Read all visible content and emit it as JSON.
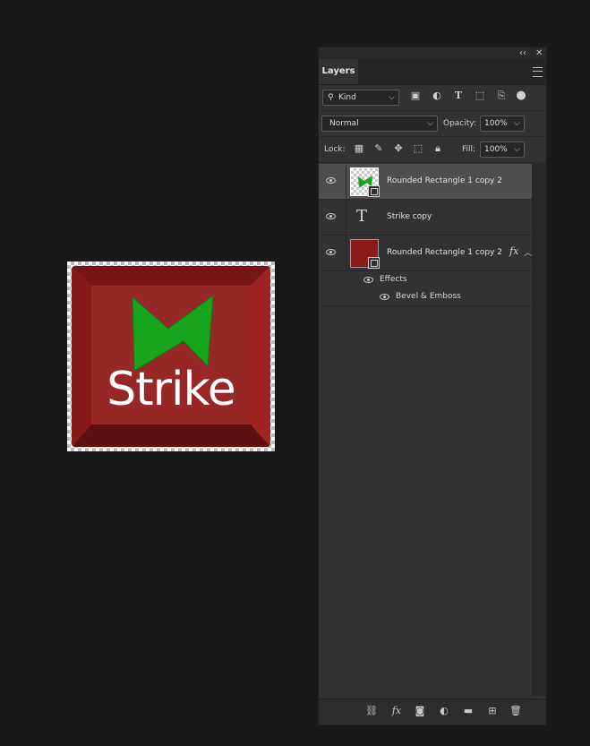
{
  "canvas": {
    "text": "Strike",
    "colors": {
      "key": "#8f1f1f",
      "face": "#982828",
      "bolt": "#17a51e",
      "text": "#ffffff"
    }
  },
  "panel": {
    "top_controls": {
      "collapse": "‹‹",
      "close": "✕"
    },
    "tab": "Layers",
    "filter": {
      "kind_label": "Kind",
      "icons": [
        "image-filter-icon",
        "adjustment-filter-icon",
        "type-filter-icon",
        "shape-filter-icon",
        "smart-object-filter-icon",
        "filter-toggle-icon"
      ]
    },
    "blend": {
      "mode": "Normal",
      "opacity_label": "Opacity:",
      "opacity_value": "100%"
    },
    "lock": {
      "label": "Lock:",
      "icons": [
        "lock-transparent-icon",
        "lock-paint-icon",
        "lock-position-icon",
        "lock-artboard-icon",
        "lock-all-icon"
      ],
      "fill_label": "Fill:",
      "fill_value": "100%"
    },
    "layers": [
      {
        "name": "Rounded Rectangle 1 copy 2",
        "type": "smart-object",
        "selected": true
      },
      {
        "name": "Strike copy",
        "type": "text",
        "selected": false
      },
      {
        "name": "Rounded Rectangle 1 copy 2",
        "type": "smart-object",
        "selected": false,
        "fx": "fx",
        "effects": {
          "label": "Effects",
          "items": [
            "Bevel & Emboss"
          ]
        }
      }
    ],
    "footer_icons": [
      "link-layers-icon",
      "add-style-icon",
      "add-mask-icon",
      "adjustment-layer-icon",
      "new-group-icon",
      "new-layer-icon",
      "delete-layer-icon"
    ]
  }
}
